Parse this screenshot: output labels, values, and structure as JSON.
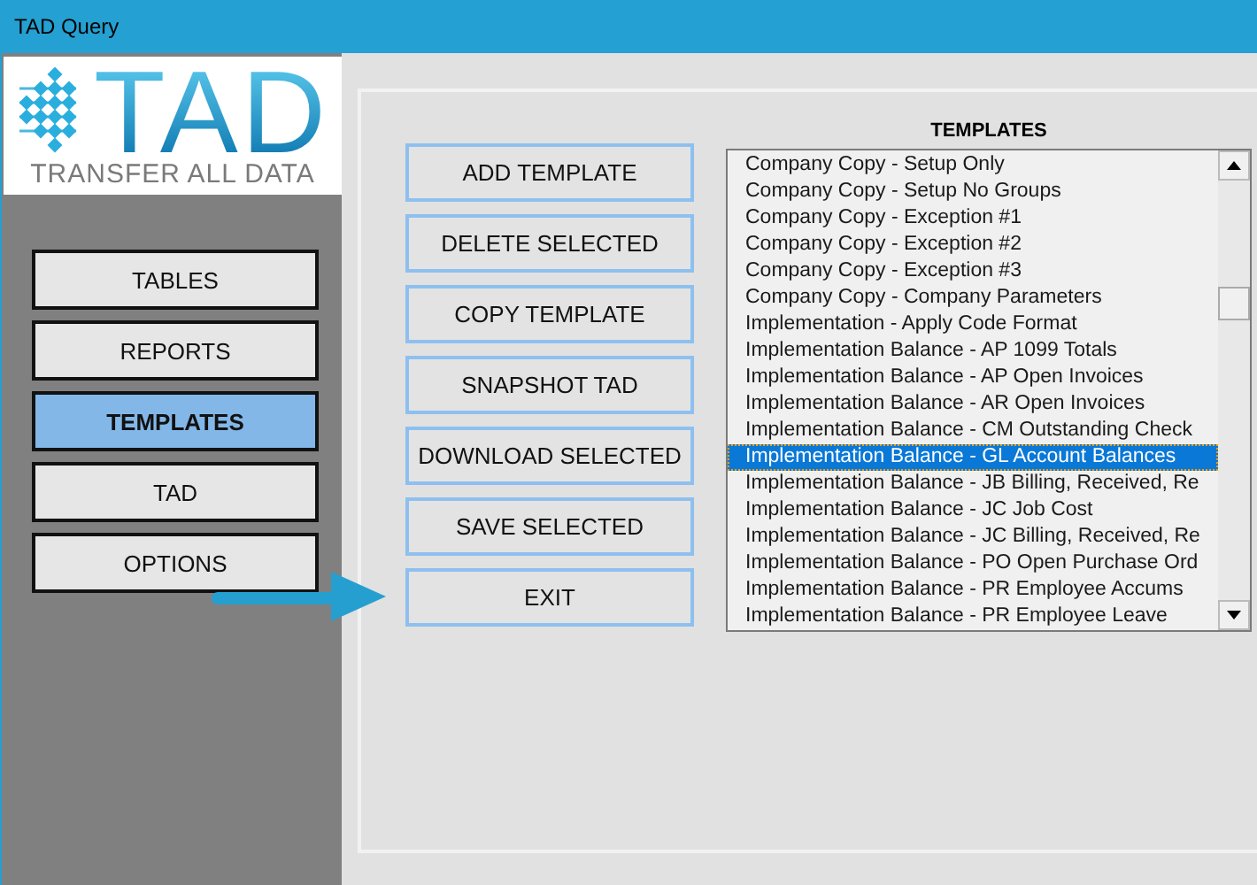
{
  "window": {
    "title": "TAD Query"
  },
  "logo": {
    "title": "TAD",
    "tagline": "TRANSFER ALL DATA"
  },
  "nav": [
    {
      "label": "TABLES",
      "selected": false
    },
    {
      "label": "REPORTS",
      "selected": false
    },
    {
      "label": "TEMPLATES",
      "selected": true
    },
    {
      "label": "TAD",
      "selected": false
    },
    {
      "label": "OPTIONS",
      "selected": false
    }
  ],
  "actions": [
    "ADD TEMPLATE",
    "DELETE SELECTED",
    "COPY TEMPLATE",
    "SNAPSHOT TAD",
    "DOWNLOAD SELECTED",
    "SAVE SELECTED",
    "EXIT"
  ],
  "templates": {
    "heading": "TEMPLATES",
    "items": [
      {
        "label": "Company Copy - Setup Only",
        "selected": false
      },
      {
        "label": "Company Copy - Setup No Groups",
        "selected": false
      },
      {
        "label": "Company Copy - Exception #1",
        "selected": false
      },
      {
        "label": "Company Copy - Exception #2",
        "selected": false
      },
      {
        "label": "Company Copy - Exception #3",
        "selected": false
      },
      {
        "label": "Company Copy - Company Parameters",
        "selected": false
      },
      {
        "label": "Implementation - Apply Code Format",
        "selected": false
      },
      {
        "label": "Implementation Balance - AP 1099 Totals",
        "selected": false
      },
      {
        "label": "Implementation Balance - AP Open Invoices",
        "selected": false
      },
      {
        "label": "Implementation Balance - AR Open Invoices",
        "selected": false
      },
      {
        "label": "Implementation Balance - CM Outstanding Check",
        "selected": false
      },
      {
        "label": "Implementation Balance - GL Account Balances",
        "selected": true
      },
      {
        "label": "Implementation Balance - JB Billing, Received, Re",
        "selected": false
      },
      {
        "label": "Implementation Balance - JC Job Cost",
        "selected": false
      },
      {
        "label": "Implementation Balance - JC Billing, Received, Re",
        "selected": false
      },
      {
        "label": "Implementation Balance - PO Open Purchase Ord",
        "selected": false
      },
      {
        "label": "Implementation Balance - PR Employee Accums",
        "selected": false
      },
      {
        "label": "Implementation Balance - PR Employee Leave",
        "selected": false
      }
    ]
  }
}
